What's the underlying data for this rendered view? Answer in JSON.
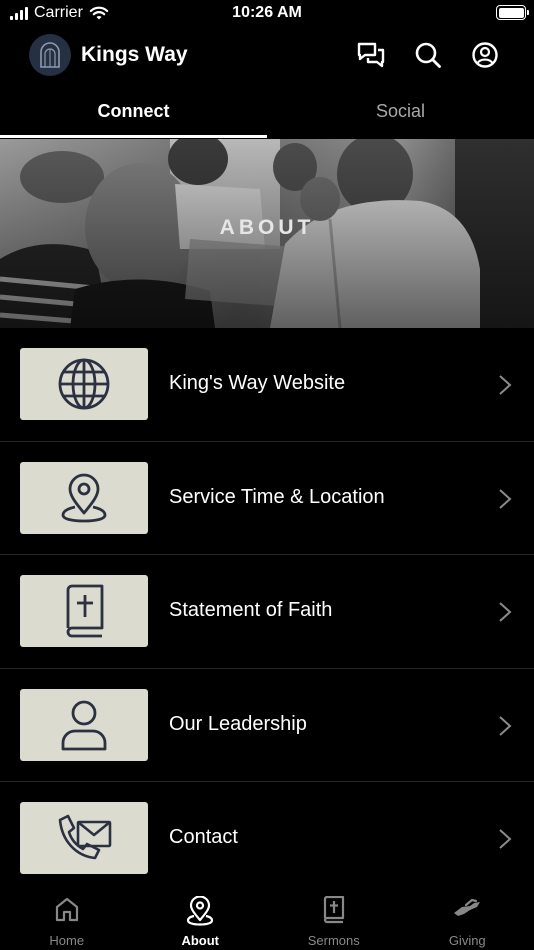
{
  "status_bar": {
    "carrier": "Carrier",
    "time": "10:26 AM"
  },
  "header": {
    "title": "Kings Way",
    "icons": [
      "chat-icon",
      "search-icon",
      "profile-icon"
    ]
  },
  "tabs": [
    {
      "label": "Connect",
      "active": true
    },
    {
      "label": "Social",
      "active": false
    }
  ],
  "banner": {
    "title": "ABOUT"
  },
  "list": [
    {
      "label": "King's Way Website",
      "icon": "globe-icon"
    },
    {
      "label": "Service Time & Location",
      "icon": "location-pin-icon"
    },
    {
      "label": "Statement of Faith",
      "icon": "bible-icon"
    },
    {
      "label": "Our Leadership",
      "icon": "person-icon"
    },
    {
      "label": "Contact",
      "icon": "phone-mail-icon"
    }
  ],
  "bottom_nav": [
    {
      "label": "Home",
      "icon": "home-icon",
      "active": false
    },
    {
      "label": "About",
      "icon": "location-pin-icon",
      "active": true
    },
    {
      "label": "Sermons",
      "icon": "bible-icon",
      "active": false
    },
    {
      "label": "Giving",
      "icon": "giving-hand-icon",
      "active": false
    }
  ],
  "colors": {
    "background": "#000000",
    "tile": "#dcdbd0",
    "icon_ink": "#2b3141",
    "inactive_tab": "#a9a9a9",
    "nav_inactive": "#888888"
  }
}
